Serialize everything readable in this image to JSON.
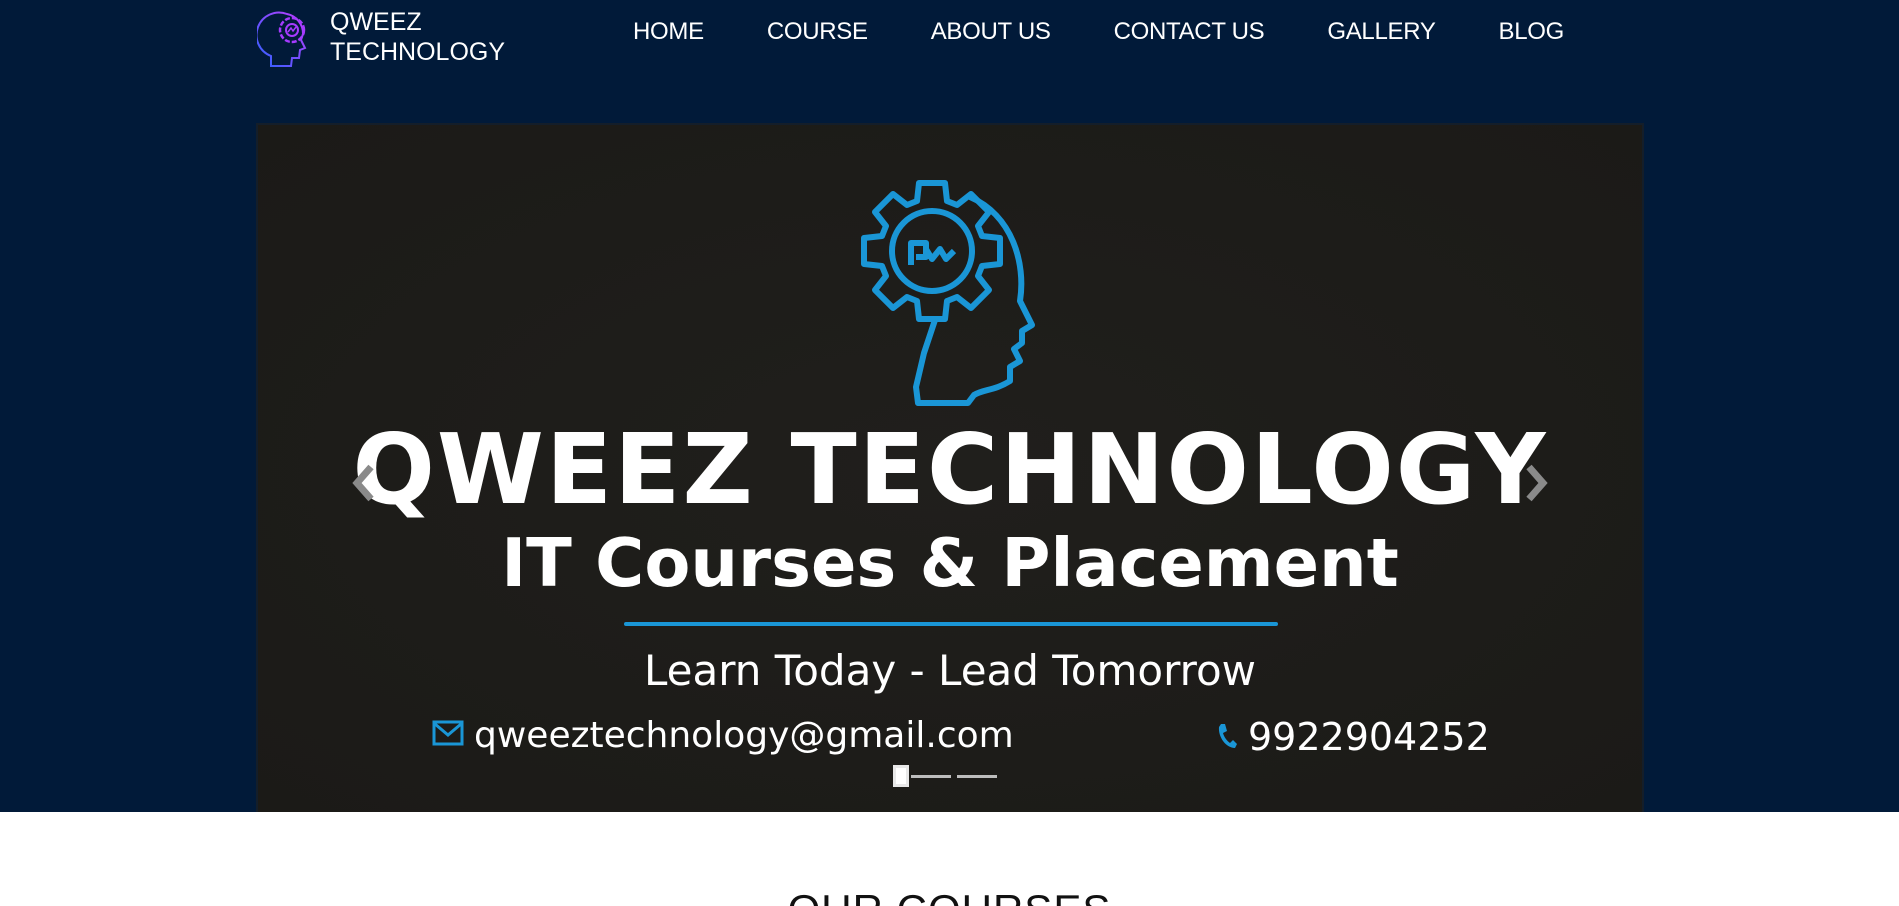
{
  "header": {
    "brand_line1": "QWEEZ",
    "brand_line2": "TECHNOLOGY",
    "nav": [
      "HOME",
      "COURSE",
      "ABOUT US",
      "CONTACT US",
      "GALLERY",
      "BLOG"
    ]
  },
  "hero": {
    "title": "QWEEZ TECHNOLOGY",
    "subtitle": "IT Courses & Placement",
    "tagline": "Learn Today - Lead Tomorrow",
    "email": "qweeztechnology@gmail.com",
    "phone": "9922904252",
    "icons": {
      "logo": "gear-head-icon",
      "email": "mail-icon",
      "phone": "phone-icon",
      "prev": "chevron-left-icon",
      "next": "chevron-right-icon"
    },
    "slides": 3,
    "active_slide": 1
  },
  "courses": {
    "heading": "OUR COURSES"
  },
  "colors": {
    "background": "#011a39",
    "slide_bg": "#1e1d1a",
    "accent": "#1a96d6",
    "text": "#ffffff"
  }
}
